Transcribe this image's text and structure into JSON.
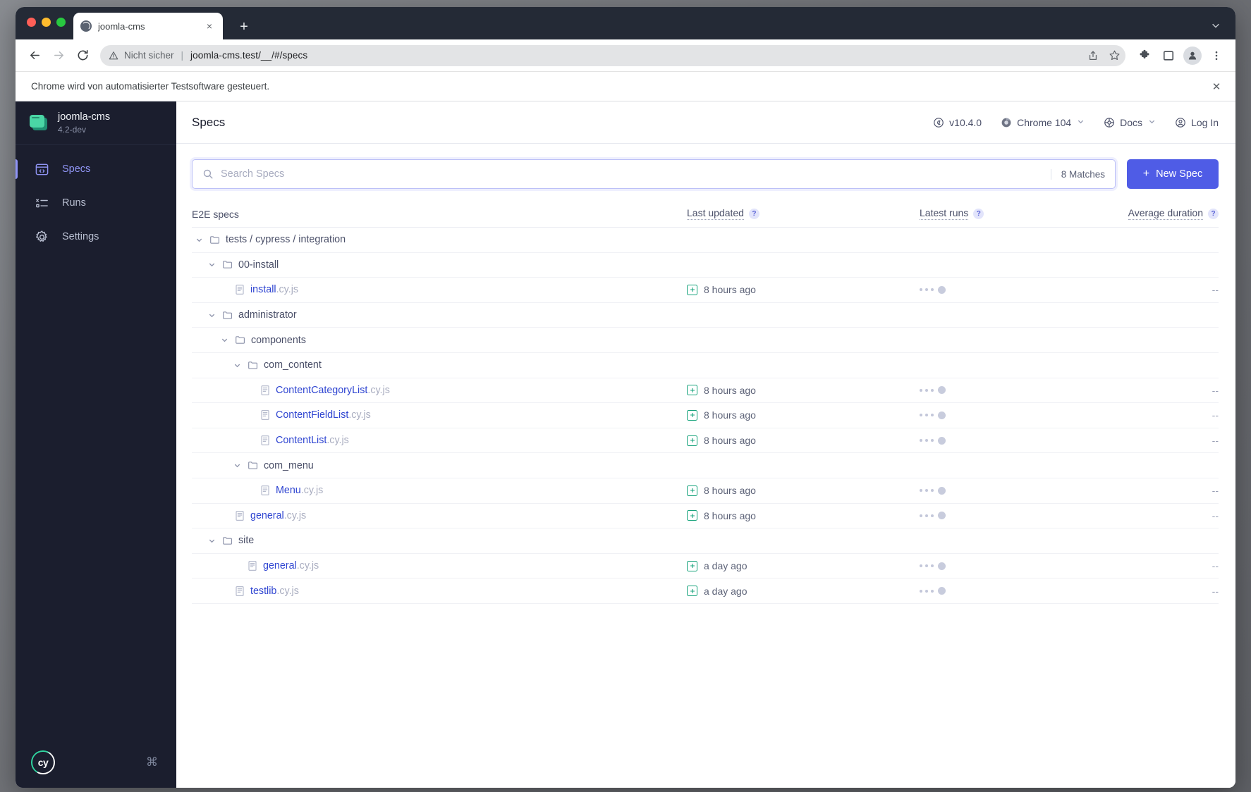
{
  "browser": {
    "tab": {
      "title": "joomla-cms",
      "favicon": "globe-icon",
      "close": "×"
    },
    "new_tab": "+",
    "tabstrip_chevron": "⌄",
    "toolbar": {
      "back": "←",
      "forward": "→",
      "reload": "⟳",
      "security_warning": "Nicht sicher",
      "separator": "|",
      "url": "joomla-cms.test/__/#/specs",
      "share_icon": "share-icon",
      "bookmark_icon": "star-icon",
      "extensions_icon": "puzzle-icon",
      "sidepanel_icon": "side-panel-icon",
      "profile_icon": "person-icon",
      "menu_icon": "kebab-menu-icon"
    },
    "infobar": {
      "text": "Chrome wird von automatisierter Testsoftware gesteuert.",
      "close": "✕"
    }
  },
  "sidebar": {
    "project": {
      "name": "joomla-cms",
      "version": "4.2-dev"
    },
    "items": [
      {
        "label": "Specs",
        "icon": "specs-icon",
        "active": true
      },
      {
        "label": "Runs",
        "icon": "runs-icon",
        "active": false
      },
      {
        "label": "Settings",
        "icon": "gear-icon",
        "active": false
      }
    ],
    "footer": {
      "logo_text": "cy",
      "keyboard_shortcut": "⌘"
    }
  },
  "header": {
    "title": "Specs",
    "links": [
      {
        "label": "v10.4.0",
        "icon": "cypress-icon",
        "chevron": false
      },
      {
        "label": "Chrome 104",
        "icon": "chrome-icon",
        "chevron": true
      },
      {
        "label": "Docs",
        "icon": "docs-icon",
        "chevron": true
      },
      {
        "label": "Log In",
        "icon": "user-circle-icon",
        "chevron": false
      }
    ]
  },
  "search": {
    "placeholder": "Search Specs",
    "value": "",
    "matches": "8 Matches",
    "icon": "search-icon"
  },
  "new_spec_button": {
    "label": "New Spec",
    "plus": "+"
  },
  "table": {
    "columns": [
      {
        "label": "E2E specs",
        "help": false
      },
      {
        "label": "Last updated",
        "help": true,
        "help_glyph": "?"
      },
      {
        "label": "Latest runs",
        "help": true,
        "help_glyph": "?"
      },
      {
        "label": "Average duration",
        "help": true,
        "help_glyph": "?"
      }
    ],
    "rows": [
      {
        "type": "folder",
        "depth": 0,
        "name": "tests / cypress / integration",
        "chevron": "⌄"
      },
      {
        "type": "folder",
        "depth": 1,
        "name": "00-install",
        "chevron": "⌄"
      },
      {
        "type": "file",
        "depth": 2,
        "name": "install",
        "ext": ".cy.js",
        "last_updated": "8 hours ago",
        "latest_runs": "placeholder",
        "average_duration": "--"
      },
      {
        "type": "folder",
        "depth": 1,
        "name": "administrator",
        "chevron": "⌄"
      },
      {
        "type": "folder",
        "depth": 2,
        "name": "components",
        "chevron": "⌄"
      },
      {
        "type": "folder",
        "depth": 3,
        "name": "com_content",
        "chevron": "⌄"
      },
      {
        "type": "file",
        "depth": 4,
        "name": "ContentCategoryList",
        "ext": ".cy.js",
        "last_updated": "8 hours ago",
        "latest_runs": "placeholder",
        "average_duration": "--"
      },
      {
        "type": "file",
        "depth": 4,
        "name": "ContentFieldList",
        "ext": ".cy.js",
        "last_updated": "8 hours ago",
        "latest_runs": "placeholder",
        "average_duration": "--"
      },
      {
        "type": "file",
        "depth": 4,
        "name": "ContentList",
        "ext": ".cy.js",
        "last_updated": "8 hours ago",
        "latest_runs": "placeholder",
        "average_duration": "--"
      },
      {
        "type": "folder",
        "depth": 3,
        "name": "com_menu",
        "chevron": "⌄"
      },
      {
        "type": "file",
        "depth": 4,
        "name": "Menu",
        "ext": ".cy.js",
        "last_updated": "8 hours ago",
        "latest_runs": "placeholder",
        "average_duration": "--"
      },
      {
        "type": "file",
        "depth": 2,
        "name": "general",
        "ext": ".cy.js",
        "last_updated": "8 hours ago",
        "latest_runs": "placeholder",
        "average_duration": "--"
      },
      {
        "type": "folder",
        "depth": 1,
        "name": "site",
        "chevron": "⌄"
      },
      {
        "type": "file",
        "depth": 3,
        "name": "general",
        "ext": ".cy.js",
        "last_updated": "a day ago",
        "latest_runs": "placeholder",
        "average_duration": "--"
      },
      {
        "type": "file",
        "depth": 2,
        "name": "testlib",
        "ext": ".cy.js",
        "last_updated": "a day ago",
        "latest_runs": "placeholder",
        "average_duration": "--"
      }
    ]
  },
  "colors": {
    "sidebar_bg": "#1b1e2e",
    "accent": "#4f5ce6",
    "link": "#2e44d1",
    "git_green": "#16a37b",
    "active_nav": "#9095f5"
  }
}
